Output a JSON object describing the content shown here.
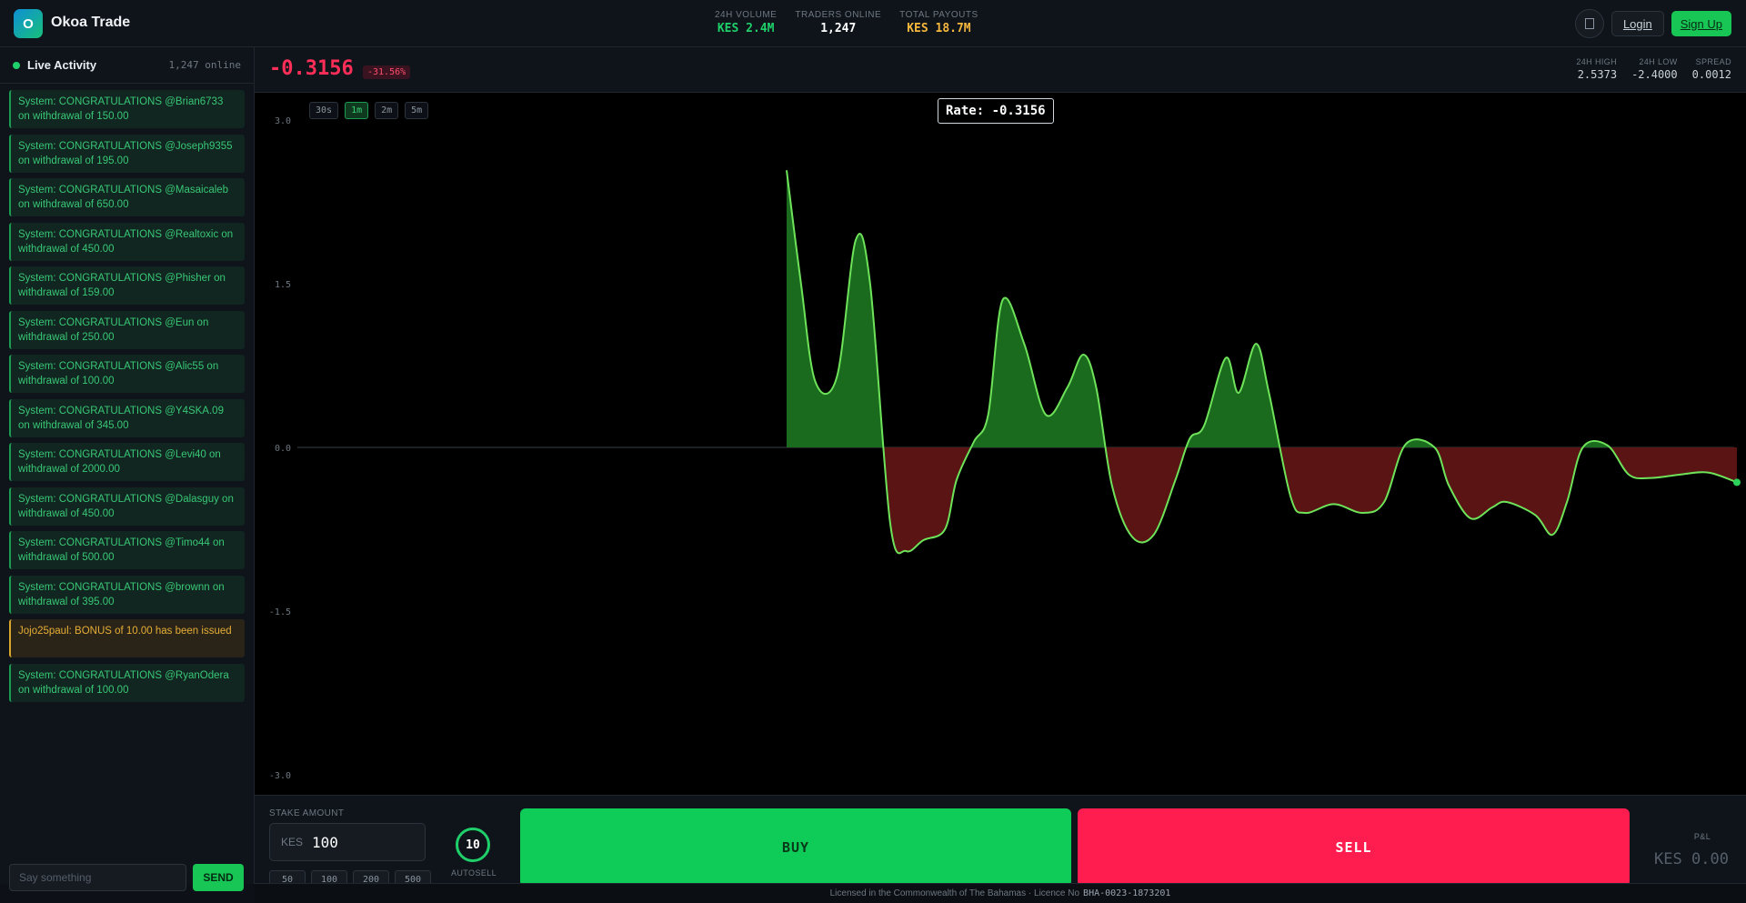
{
  "header": {
    "logo_letter": "O",
    "brand": "Okoa Trade",
    "stats": [
      {
        "label": "24H VOLUME",
        "value": "KES 2.4M",
        "color": "#1fd06a"
      },
      {
        "label": "TRADERS ONLINE",
        "value": "1,247",
        "color": "#ffffff"
      },
      {
        "label": "TOTAL PAYOUTS",
        "value": "KES 18.7M",
        "color": "#f5b83d"
      }
    ],
    "icon_button": "",
    "login_label": "Login",
    "signup_label": "Sign Up"
  },
  "sidebar": {
    "title": "Live Activity",
    "online": "1,247 online",
    "messages": [
      {
        "text": "System: CONGRATULATIONS @Brian6733 on withdrawal of 150.00 ",
        "type": "system"
      },
      {
        "text": "System: CONGRATULATIONS @Joseph9355 on withdrawal of 195.00 ",
        "type": "system"
      },
      {
        "text": "System: CONGRATULATIONS @Masaicaleb on withdrawal of 650.00 ",
        "type": "system"
      },
      {
        "text": "System: CONGRATULATIONS @Realtoxic on withdrawal of 450.00 ",
        "type": "system"
      },
      {
        "text": "System: CONGRATULATIONS @Phisher on withdrawal of 159.00 ",
        "type": "system"
      },
      {
        "text": "System: CONGRATULATIONS @Eun on withdrawal of 250.00 ",
        "type": "system"
      },
      {
        "text": "System: CONGRATULATIONS @Alic55 on withdrawal of 100.00 ",
        "type": "system"
      },
      {
        "text": "System: CONGRATULATIONS @Y4SKA.09 on withdrawal of 345.00 ",
        "type": "system"
      },
      {
        "text": "System: CONGRATULATIONS @Levi40 on withdrawal of 2000.00 ",
        "type": "system"
      },
      {
        "text": "System: CONGRATULATIONS @Dalasguy on withdrawal of 450.00 ",
        "type": "system"
      },
      {
        "text": "System: CONGRATULATIONS @Timo44 on withdrawal of 500.00 ",
        "type": "system"
      },
      {
        "text": "System: CONGRATULATIONS @brownn on withdrawal of 395.00 ",
        "type": "system"
      },
      {
        "text": "Jojo25paul: BONUS of 10.00 has been issued ",
        "type": "bonus"
      },
      {
        "text": "System: CONGRATULATIONS @RyanOdera on withdrawal of 100.00 ",
        "type": "system"
      }
    ],
    "chat_placeholder": "Say something",
    "send_label": "SEND"
  },
  "ticker": {
    "price": "-0.3156",
    "change": "-31.56%",
    "high_label": "24H HIGH",
    "high": "2.5373",
    "low_label": "24H LOW",
    "low": "-2.4000",
    "spread_label": "SPREAD",
    "spread": "0.0012"
  },
  "chart": {
    "timeframes": [
      "30s",
      "1m",
      "2m",
      "5m"
    ],
    "active_timeframe": "1m",
    "rate_label": "Rate: -0.3156"
  },
  "chart_data": {
    "type": "area",
    "y_ticks": [
      "3.0",
      "1.5",
      "0.0",
      "-1.5",
      "-3.0"
    ],
    "ylim": [
      -3.0,
      3.0
    ],
    "baseline": 0.0,
    "grid": false,
    "positive_color": "#1a6b1e",
    "negative_color": "#5a1414",
    "line_color": "#6ee35a",
    "x": [
      0.0,
      0.25,
      0.5,
      0.75,
      1.0,
      1.25,
      1.5,
      1.75,
      2.0,
      2.25,
      2.5,
      2.75,
      3.0,
      3.25,
      3.5,
      3.75,
      4.0,
      4.25,
      4.5,
      4.75,
      5.0,
      5.25,
      5.5,
      5.75,
      6.0,
      6.25,
      6.5,
      6.75,
      7.0,
      7.25,
      7.5,
      7.75,
      8.0,
      8.25,
      8.5,
      8.75,
      9.0,
      9.25,
      9.5,
      9.75,
      10.0,
      10.25,
      10.5,
      10.75,
      11.0,
      11.25,
      11.5,
      11.75,
      12.0,
      12.25,
      12.5,
      12.75,
      13.0,
      13.25,
      13.5,
      13.75,
      14.0,
      14.25,
      14.5,
      14.75,
      15.0,
      15.25,
      15.5,
      15.75,
      16.0,
      16.25,
      16.5,
      16.75,
      17.0,
      17.25,
      17.5,
      17.75,
      18.0,
      18.25,
      18.5,
      18.75,
      19.0,
      19.25,
      19.5,
      19.75,
      20.0,
      20.25,
      20.5,
      20.75,
      21.0,
      21.25,
      21.5,
      21.75,
      22.0,
      22.25,
      22.5,
      22.75,
      23.0,
      23.25,
      23.5,
      23.75,
      24.0,
      24.25,
      24.5,
      24.75,
      25.0,
      25.25,
      25.5,
      25.75,
      26.0,
      26.25,
      26.5,
      26.75,
      27.0,
      27.25,
      27.5,
      27.75,
      28.0,
      28.25,
      28.5,
      28.75,
      29.0,
      29.25,
      29.5,
      29.75,
      30.0,
      30.25,
      30.5,
      30.75,
      31.0,
      31.25,
      31.5,
      31.75,
      32.0,
      32.25,
      32.5,
      32.75,
      33.0,
      33.25,
      33.5,
      33.75,
      34.0,
      34.25,
      34.5,
      34.75,
      35.0,
      35.25,
      35.5,
      35.75,
      36.0,
      36.25,
      36.5,
      36.75,
      37.0,
      37.25,
      37.5,
      37.75,
      38.0,
      38.25,
      38.5,
      38.75,
      39.0,
      39.25,
      39.5,
      39.75,
      40.0,
      40.25,
      40.5,
      40.75,
      41.0,
      41.25,
      41.5,
      41.75,
      42.0,
      42.25,
      42.5,
      42.75,
      43.0,
      43.25,
      43.5,
      43.75,
      44.0,
      44.25,
      44.5,
      44.75,
      45.0,
      45.25,
      45.5,
      45.75,
      46.0,
      46.25,
      46.5,
      46.75,
      47.0,
      47.25,
      47.5,
      47.75,
      48.0,
      48.25,
      48.5,
      48.75,
      49.0,
      49.25,
      49.5,
      49.75,
      50.0,
      50.25,
      50.5,
      50.75,
      51.0,
      51.25,
      51.5,
      51.75,
      52.0,
      52.25,
      52.5,
      52.75,
      53.0,
      53.25,
      53.5,
      53.75,
      54.0,
      54.25,
      54.5,
      54.75,
      55.0,
      55.25,
      55.5,
      55.75,
      56.0,
      56.25,
      56.5,
      56.75,
      57.0,
      57.25,
      57.5,
      57.75,
      58.0,
      58.25,
      58.5,
      58.75,
      59.0,
      59.25,
      59.5,
      59.75,
      60.0,
      60.25,
      60.5,
      60.75,
      61.0,
      61.25,
      61.5,
      61.75,
      62.0,
      62.25,
      62.5,
      62.75,
      63.0,
      63.25,
      63.5,
      63.75,
      64.0,
      64.25,
      64.5,
      64.75,
      65.0,
      65.25,
      65.5,
      65.75,
      66.0,
      66.25,
      66.5,
      66.75,
      67.0,
      67.25,
      67.5,
      67.75,
      68.0,
      68.25,
      68.5,
      68.75,
      69.0,
      69.25,
      69.5,
      69.75,
      70.0,
      70.25,
      70.5,
      70.75,
      71.0,
      71.25,
      71.5,
      71.75,
      72.0,
      72.25,
      72.5,
      72.75,
      73.0,
      73.25,
      73.5,
      73.75,
      74.0,
      74.25,
      74.5,
      74.75,
      75.0,
      75.25,
      75.5,
      75.75,
      76.0,
      76.25,
      76.5,
      76.75,
      77.0,
      77.25,
      77.5,
      77.75,
      78.0,
      78.25,
      78.5,
      78.75,
      79.0,
      79.25,
      79.5,
      79.75,
      80.0,
      80.25,
      80.5,
      80.75,
      81.0,
      81.25,
      81.5,
      81.75,
      82.0,
      82.25,
      82.5,
      82.75,
      83.0,
      83.25,
      83.5,
      83.75,
      84.0,
      84.25,
      84.5,
      84.75,
      85.0,
      85.25,
      85.5,
      85.75,
      86.0,
      86.25,
      86.5,
      86.75,
      87.0,
      87.25,
      87.5,
      87.75,
      88.0,
      88.25,
      88.5,
      88.75,
      89.0,
      89.25,
      89.5,
      89.75,
      90.0,
      90.25,
      90.5,
      90.75,
      91.0,
      91.25,
      91.5,
      91.75,
      92.0,
      92.25,
      92.5,
      92.75,
      93.0,
      93.25,
      93.5,
      93.75,
      94.0,
      94.25,
      94.5,
      94.75,
      95.0,
      95.25,
      95.5,
      95.75,
      96.0,
      96.25,
      96.5,
      96.75,
      97.0,
      97.25,
      97.5,
      97.75,
      98.0,
      98.25,
      98.5,
      98.75,
      99.0,
      99.25,
      99.5,
      99.75,
      100.0
    ],
    "x_points": [
      0,
      4,
      8,
      12,
      16,
      20,
      24,
      28,
      32,
      36,
      40,
      44,
      48,
      52,
      56,
      60,
      64,
      68,
      72,
      76,
      80,
      84,
      88,
      92,
      96,
      100
    ],
    "values": []
  },
  "controls": {
    "stake_label": "STAKE AMOUNT",
    "currency": "KES",
    "amount": "100",
    "quick_amounts": [
      "50",
      "100",
      "200",
      "500"
    ],
    "autosell_value": "10",
    "autosell_label": "AUTOSELL",
    "buy_label": "BUY",
    "sell_label": "SELL",
    "pnl_label": "P&L",
    "pnl_value": "KES 0.00"
  },
  "footer": {
    "text": "Licensed in the Commonwealth of The Bahamas · Licence No",
    "licence": "BHA-0023-1873201"
  }
}
